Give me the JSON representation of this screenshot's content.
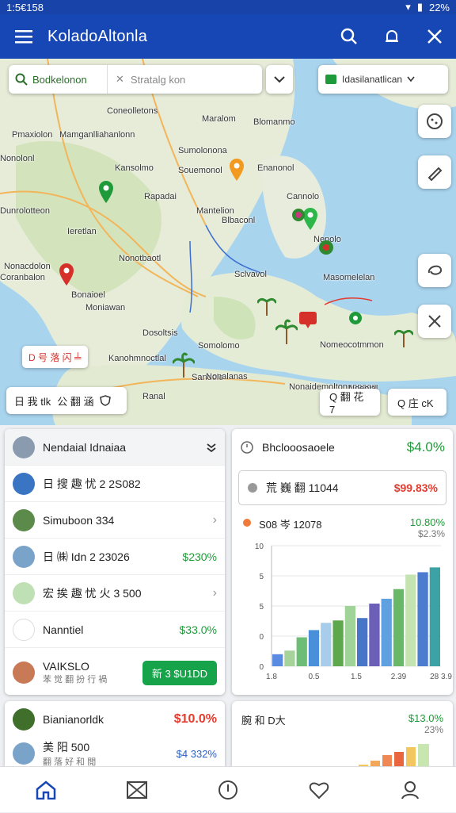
{
  "status": {
    "time": "1:5€158",
    "battery": "22%"
  },
  "app": {
    "title": "KoladoAltonla"
  },
  "search": {
    "query": "Bodkelonon",
    "placeholder": "Stratalg kon",
    "layer_label": "Idasilanatlican"
  },
  "map_labels": [
    "Coneolletons",
    "Maralom",
    "Mamganlliahanlonn",
    "Blomanmo",
    "Pmaxiolon",
    "Sumolonona",
    "Souemonol",
    "Enanonol",
    "Nonolonl",
    "Kansolmo",
    "Rapadai",
    "Dunrolotteon",
    "Mantelion",
    "Cannolo",
    "Blbaconl",
    "Ieretlan",
    "Nenolo",
    "Nonotbaotl",
    "Nonacdolon",
    "Sclvavol",
    "Coranbalon",
    "Masomelelan",
    "Bonaioel",
    "Moniawan",
    "Dosoltsis",
    "Nomeocotmmon",
    "Somolomo",
    "Kanohmnoctlal",
    "Sandolo",
    "Nonaidemoltonnonaon",
    "Nonalanas",
    "Noeoial",
    "Ranal"
  ],
  "map_pill": {
    "left_label": "日 我 tlk",
    "left_label2": "公 翻 涵",
    "badge": "D 号 落 闪 ╧"
  },
  "map_chips": [
    {
      "label": "Q 翻 花 7"
    },
    {
      "label": "Q 庄 cK"
    }
  ],
  "left_card": {
    "header": "Nendaial Idnaiaa",
    "rows": [
      {
        "label": "日 搜 趣 忧 2 2S082",
        "value": "",
        "chevron": false
      },
      {
        "label": "Simuboon 334",
        "value": "",
        "chevron": true
      },
      {
        "label": "日 ㈱ Idn 2 23026",
        "value": "$230%",
        "chevron": false
      },
      {
        "label": "宏 挨 趣 忧 火 3 500",
        "value": "",
        "chevron": true
      },
      {
        "label": "Nanntiel",
        "value": "$33.0%",
        "chevron": false
      }
    ],
    "last": {
      "title": "VAIKSLO",
      "sub": "苯 觉 翻 扮 行 禍",
      "button": "新 3 $U1DD"
    }
  },
  "right_card": {
    "header": {
      "label": "Bhclooosaoele",
      "value": "$4.0%"
    },
    "boxed": {
      "label": "荒 巍 翻 11044",
      "value": "$99.83%"
    },
    "legend": {
      "label": "S08 岑 12078",
      "v1": "10.80%",
      "v2": "$2.3%"
    },
    "yticks": [
      "10",
      "5",
      "5",
      "0",
      "0"
    ],
    "xticks": [
      "1.8",
      "0.5",
      "1.5",
      "2.39",
      "28 3.9"
    ]
  },
  "chart_data": {
    "type": "bar",
    "title": "",
    "xlabel": "",
    "ylabel": "",
    "ylim": [
      0,
      10
    ],
    "values": [
      1.0,
      1.3,
      2.4,
      3.0,
      3.6,
      3.8,
      5.0,
      4.0,
      5.2,
      5.6,
      6.4,
      7.6,
      7.8,
      8.2
    ],
    "colors": [
      "#5b8be0",
      "#a6d39a",
      "#6cbe77",
      "#4a8fd9",
      "#a8cdea",
      "#5da84c",
      "#9fd397",
      "#4776c8",
      "#6b5fb8",
      "#5fa0e0",
      "#69b867",
      "#c3e3b0",
      "#4b7cd0",
      "#3da2a5"
    ]
  },
  "bottom_left": {
    "title": "Bianianorldk",
    "value": "$10.0%",
    "row_label": "美 阳 500",
    "row_sub": "翻 落 好 和 閲",
    "row_value": "$4 332%"
  },
  "bottom_right": {
    "title": "腕 和 D大",
    "v1": "$13.0%",
    "v2": "23%"
  },
  "colors": {
    "primary": "#1747b5",
    "green": "#1e9b38",
    "red": "#e33b2e"
  }
}
